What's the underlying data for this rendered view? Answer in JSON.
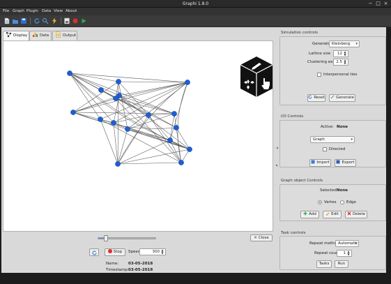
{
  "window": {
    "title": "Graphi 1.8.0",
    "minimize": "−",
    "maximize": "□",
    "close": "×"
  },
  "menu": [
    "File",
    "Graph",
    "Plugin",
    "Data",
    "View",
    "About"
  ],
  "toolbar": {
    "icons": [
      "new-file-icon",
      "open-folder-icon",
      "save-icon",
      "refresh-icon",
      "search-icon",
      "lightning-icon",
      "save-image-icon",
      "record-icon",
      "play-icon"
    ]
  },
  "tabs": [
    {
      "label": "Display",
      "icon": "display-icon",
      "active": true
    },
    {
      "label": "Data",
      "icon": "bar-chart-icon",
      "active": false
    },
    {
      "label": "Output",
      "icon": "document-icon",
      "active": false
    }
  ],
  "graph": {
    "node_color": "#1a5fd6",
    "edge_color": "#555555",
    "node_count": 17
  },
  "playback": {
    "close_label": "Close",
    "stop_label": "Stop",
    "speed_label": "Speed",
    "speed_value": "300",
    "progress": 0.14
  },
  "info": {
    "name_label": "Name:",
    "name_value": "03-05-2018",
    "timestamp_label": "Timestamp:",
    "timestamp_value": "03-05-2018"
  },
  "simulation": {
    "title": "Simulation controls",
    "generator_label": "Generator",
    "generator_value": "Kleinberg",
    "lattice_label": "Lattice size",
    "lattice_value": "12",
    "clustering_label": "Clustering exp.",
    "clustering_value": "2.5",
    "interpersonal_label": "Interpersonal ties",
    "reset_label": "Reset",
    "generate_label": "Generate"
  },
  "io": {
    "title": "I/O Controls",
    "active_label": "Active:",
    "active_value": "None",
    "type_value": "Graph",
    "directed_label": "Directed",
    "import_label": "Import",
    "export_label": "Export"
  },
  "object": {
    "title": "Graph object Controls",
    "selected_label": "Selected:",
    "selected_value": "None",
    "vertex_label": "Vertex",
    "edge_label": "Edge",
    "add_label": "Add",
    "edit_label": "Edit",
    "delete_label": "Delete"
  },
  "tasks": {
    "title": "Task controls",
    "repeat_method_label": "Repeat method",
    "repeat_method_value": "Automatic",
    "repeat_count_label": "Repeat count",
    "repeat_count_value": "1",
    "tasks_label": "Tasks",
    "run_label": "Run"
  }
}
